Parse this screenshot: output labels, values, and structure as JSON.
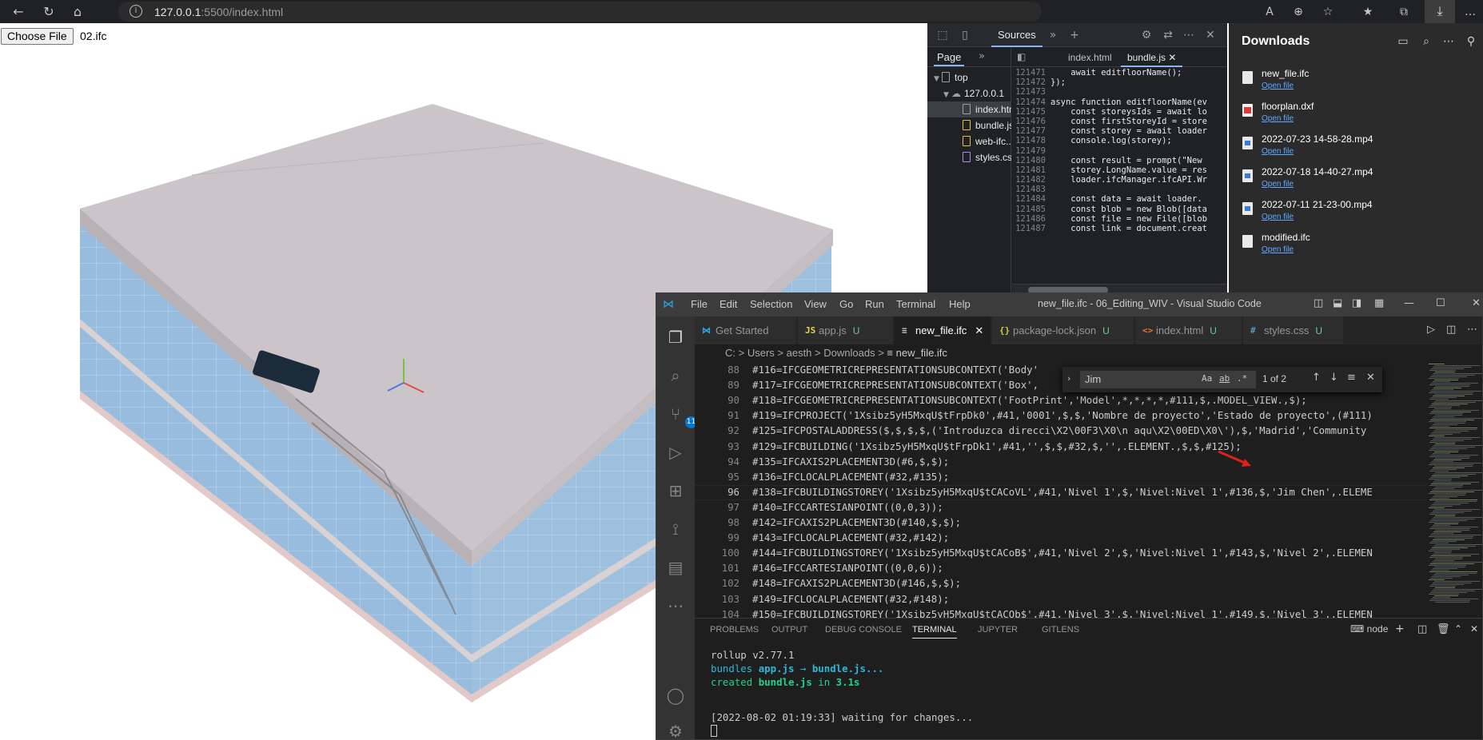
{
  "browser": {
    "url": "127.0.0.1:5500/index.html",
    "url_host": "127.0.0.1",
    "url_rest": ":5500/index.html",
    "icons": [
      "back-icon",
      "refresh-icon",
      "home-icon",
      "info-icon",
      "read-aloud-icon",
      "zoom-icon",
      "favorite-add-icon",
      "favorites-icon",
      "collections-icon",
      "downloads-icon",
      "more-icon"
    ]
  },
  "page": {
    "choose_file_label": "Choose File",
    "file_name": "02.ifc"
  },
  "devtools": {
    "sources_tab": "Sources",
    "page_tab": "Page",
    "tree": {
      "top": "top",
      "host": "127.0.0.1",
      "files": [
        "index.html",
        "bundle.js",
        "web-ifc...",
        "styles.css"
      ]
    },
    "editor_tabs": [
      "index.html",
      "bundle.js"
    ],
    "code_lines": [
      {
        "n": "121471",
        "t": "    await editfloorName();"
      },
      {
        "n": "121472",
        "t": "});"
      },
      {
        "n": "121473",
        "t": ""
      },
      {
        "n": "121474",
        "t": "async function editfloorName(ev"
      },
      {
        "n": "121475",
        "t": "    const storeysIds = await lo"
      },
      {
        "n": "121476",
        "t": "    const firstStoreyId = store"
      },
      {
        "n": "121477",
        "t": "    const storey = await loader"
      },
      {
        "n": "121478",
        "t": "    console.log(storey);"
      },
      {
        "n": "121479",
        "t": ""
      },
      {
        "n": "121480",
        "t": "    const result = prompt(\"New"
      },
      {
        "n": "121481",
        "t": "    storey.LongName.value = res"
      },
      {
        "n": "121482",
        "t": "    loader.ifcManager.ifcAPI.Wr"
      },
      {
        "n": "121483",
        "t": ""
      },
      {
        "n": "121484",
        "t": "    const data = await loader."
      },
      {
        "n": "121485",
        "t": "    const blob = new Blob([data"
      },
      {
        "n": "121486",
        "t": "    const file = new File([blob"
      },
      {
        "n": "121487",
        "t": "    const link = document.creat"
      }
    ]
  },
  "downloads": {
    "title": "Downloads",
    "open_label": "Open file",
    "items": [
      {
        "name": "new_file.ifc",
        "icon": "file-icon"
      },
      {
        "name": "floorplan.dxf",
        "icon": "pdf-file-icon"
      },
      {
        "name": "2022-07-23 14-58-28.mp4",
        "icon": "video-file-icon"
      },
      {
        "name": "2022-07-18 14-40-27.mp4",
        "icon": "video-file-icon"
      },
      {
        "name": "2022-07-11 21-23-00.mp4",
        "icon": "video-file-icon"
      },
      {
        "name": "modified.ifc",
        "icon": "file-icon"
      }
    ]
  },
  "vscode": {
    "title": "new_file.ifc - 06_Editing_WIV - Visual Studio Code",
    "menu": [
      "File",
      "Edit",
      "Selection",
      "View",
      "Go",
      "Run",
      "Terminal",
      "Help"
    ],
    "scm_badge": "11",
    "tabs": [
      {
        "label": "Get Started",
        "icon": "vscode-logo-icon",
        "u": ""
      },
      {
        "label": "app.js",
        "icon": "js-icon",
        "u": "U"
      },
      {
        "label": "new_file.ifc",
        "icon": "file-lines-icon",
        "u": ""
      },
      {
        "label": "package-lock.json",
        "icon": "json-icon",
        "u": "U"
      },
      {
        "label": "index.html",
        "icon": "html-icon",
        "u": "U"
      },
      {
        "label": "styles.css",
        "icon": "css-icon",
        "u": "U"
      }
    ],
    "breadcrumb": [
      "C:",
      "Users",
      "aesth",
      "Downloads",
      "new_file.ifc"
    ],
    "find": {
      "query": "Jim",
      "count": "1 of 2",
      "options": [
        "Aa",
        "ab",
        ".*"
      ]
    },
    "editor_lines": [
      {
        "n": "88",
        "t": "#116=IFCGEOMETRICREPRESENTATIONSUBCONTEXT('Body'"
      },
      {
        "n": "89",
        "t": "#117=IFCGEOMETRICREPRESENTATIONSUBCONTEXT('Box',"
      },
      {
        "n": "90",
        "t": "#118=IFCGEOMETRICREPRESENTATIONSUBCONTEXT('FootPrint','Model',*,*,*,*,#111,$,.MODEL_VIEW.,$);"
      },
      {
        "n": "91",
        "t": "#119=IFCPROJECT('1Xsibz5yH5MxqU$tFrpDk0',#41,'0001',$,$,'Nombre de proyecto','Estado de proyecto',(#111)"
      },
      {
        "n": "92",
        "t": "#125=IFCPOSTALADDRESS($,$,$,$,('Introduzca direcci\\X2\\00F3\\X0\\n aqu\\X2\\00ED\\X0\\'),$,'Madrid','Community"
      },
      {
        "n": "93",
        "t": "#129=IFCBUILDING('1Xsibz5yH5MxqU$tFrpDk1',#41,'',$,$,#32,$,'',.ELEMENT.,$,$,#125);"
      },
      {
        "n": "94",
        "t": "#135=IFCAXIS2PLACEMENT3D(#6,$,$);"
      },
      {
        "n": "95",
        "t": "#136=IFCLOCALPLACEMENT(#32,#135);"
      },
      {
        "n": "96",
        "t": "#138=IFCBUILDINGSTOREY('1Xsibz5yH5MxqU$tCACoVL',#41,'Nivel 1',$,'Nivel:Nivel 1',#136,$,'Jim Chen',.ELEME"
      },
      {
        "n": "97",
        "t": "#140=IFCCARTESIANPOINT((0,0,3));"
      },
      {
        "n": "98",
        "t": "#142=IFCAXIS2PLACEMENT3D(#140,$,$);"
      },
      {
        "n": "99",
        "t": "#143=IFCLOCALPLACEMENT(#32,#142);"
      },
      {
        "n": "100",
        "t": "#144=IFCBUILDINGSTOREY('1Xsibz5yH5MxqU$tCACoB$',#41,'Nivel 2',$,'Nivel:Nivel 1',#143,$,'Nivel 2',.ELEMEN"
      },
      {
        "n": "101",
        "t": "#146=IFCCARTESIANPOINT((0,0,6));"
      },
      {
        "n": "102",
        "t": "#148=IFCAXIS2PLACEMENT3D(#146,$,$);"
      },
      {
        "n": "103",
        "t": "#149=IFCLOCALPLACEMENT(#32,#148);"
      },
      {
        "n": "104",
        "t": "#150=IFCBUILDINGSTOREY('1Xsibz5yH5MxqU$tCACQb$',#41,'Nivel 3',$,'Nivel:Nivel 1',#149,$,'Nivel 3',.ELEMEN"
      }
    ],
    "panel_tabs": [
      "PROBLEMS",
      "OUTPUT",
      "DEBUG CONSOLE",
      "TERMINAL",
      "JUPYTER",
      "GITLENS"
    ],
    "terminal_name": "node",
    "terminal": {
      "rollup": "rollup v2.77.1",
      "bundles_a": "bundles ",
      "bundles_b": "app.js",
      "bundles_c": " → ",
      "bundles_d": "bundle.js...",
      "created_a": "created ",
      "created_b": "bundle.js",
      "created_c": " in ",
      "created_d": "3.1s",
      "waiting": "[2022-08-02 01:19:33] waiting for changes..."
    }
  },
  "colors": {
    "vscode_bg": "#1e1e1e",
    "accent_blue": "#0078d4",
    "link_blue": "#5fa9ff",
    "glass_blue": "#8fb6da",
    "roof_grey": "#cbc5ca",
    "annotation_red": "#e0201b"
  }
}
